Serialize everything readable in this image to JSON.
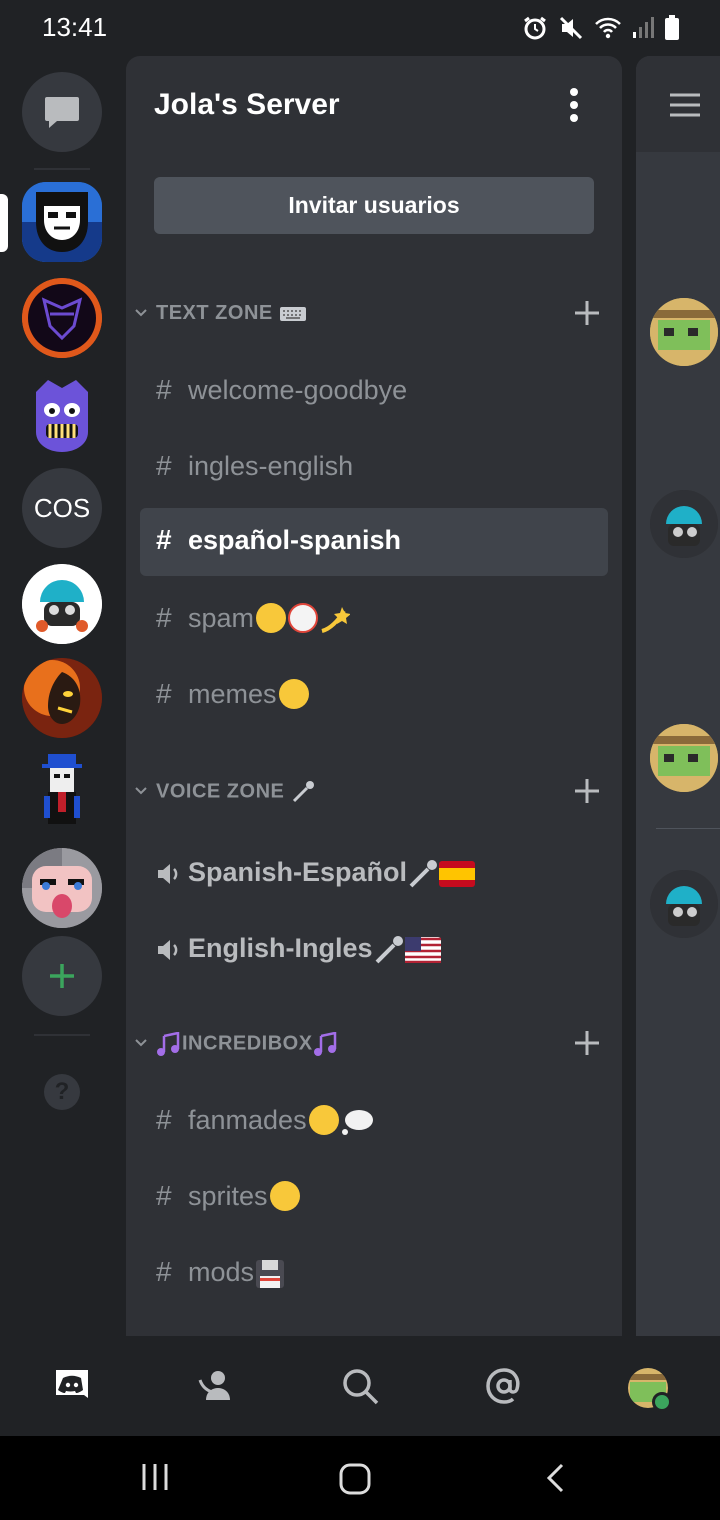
{
  "status_bar": {
    "time": "13:41"
  },
  "rail": {
    "servers": [
      {
        "name": "direct-messages"
      },
      {
        "name": "server-1"
      },
      {
        "name": "server-2"
      },
      {
        "name": "server-3"
      },
      {
        "name": "server-cos",
        "initials": "COS"
      },
      {
        "name": "server-5"
      },
      {
        "name": "server-6"
      },
      {
        "name": "server-7"
      },
      {
        "name": "server-8"
      }
    ],
    "help_label": "?"
  },
  "panel": {
    "server_name": "Jola's Server",
    "invite_label": "Invitar usuarios",
    "categories": [
      {
        "label": "TEXT ZONE",
        "channels": [
          {
            "name": "welcome-goodbye",
            "type": "text"
          },
          {
            "name": "ingles-english",
            "type": "text"
          },
          {
            "name": "español-spanish",
            "type": "text",
            "selected": true
          },
          {
            "name": "spam",
            "type": "text"
          },
          {
            "name": "memes",
            "type": "text"
          }
        ]
      },
      {
        "label": "VOICE ZONE",
        "channels": [
          {
            "name": "Spanish-Español",
            "type": "voice"
          },
          {
            "name": "English-Ingles",
            "type": "voice"
          }
        ]
      },
      {
        "label": "INCREDIBOX",
        "channels": [
          {
            "name": "fanmades",
            "type": "text"
          },
          {
            "name": "sprites",
            "type": "text"
          },
          {
            "name": "mods",
            "type": "text"
          }
        ]
      }
    ],
    "hash_symbol": "#"
  },
  "colors": {
    "background": "#202225",
    "panel": "#2f3136",
    "selected": "#40444b",
    "accent_green": "#3ba55d",
    "muted_text": "#8e9297"
  }
}
